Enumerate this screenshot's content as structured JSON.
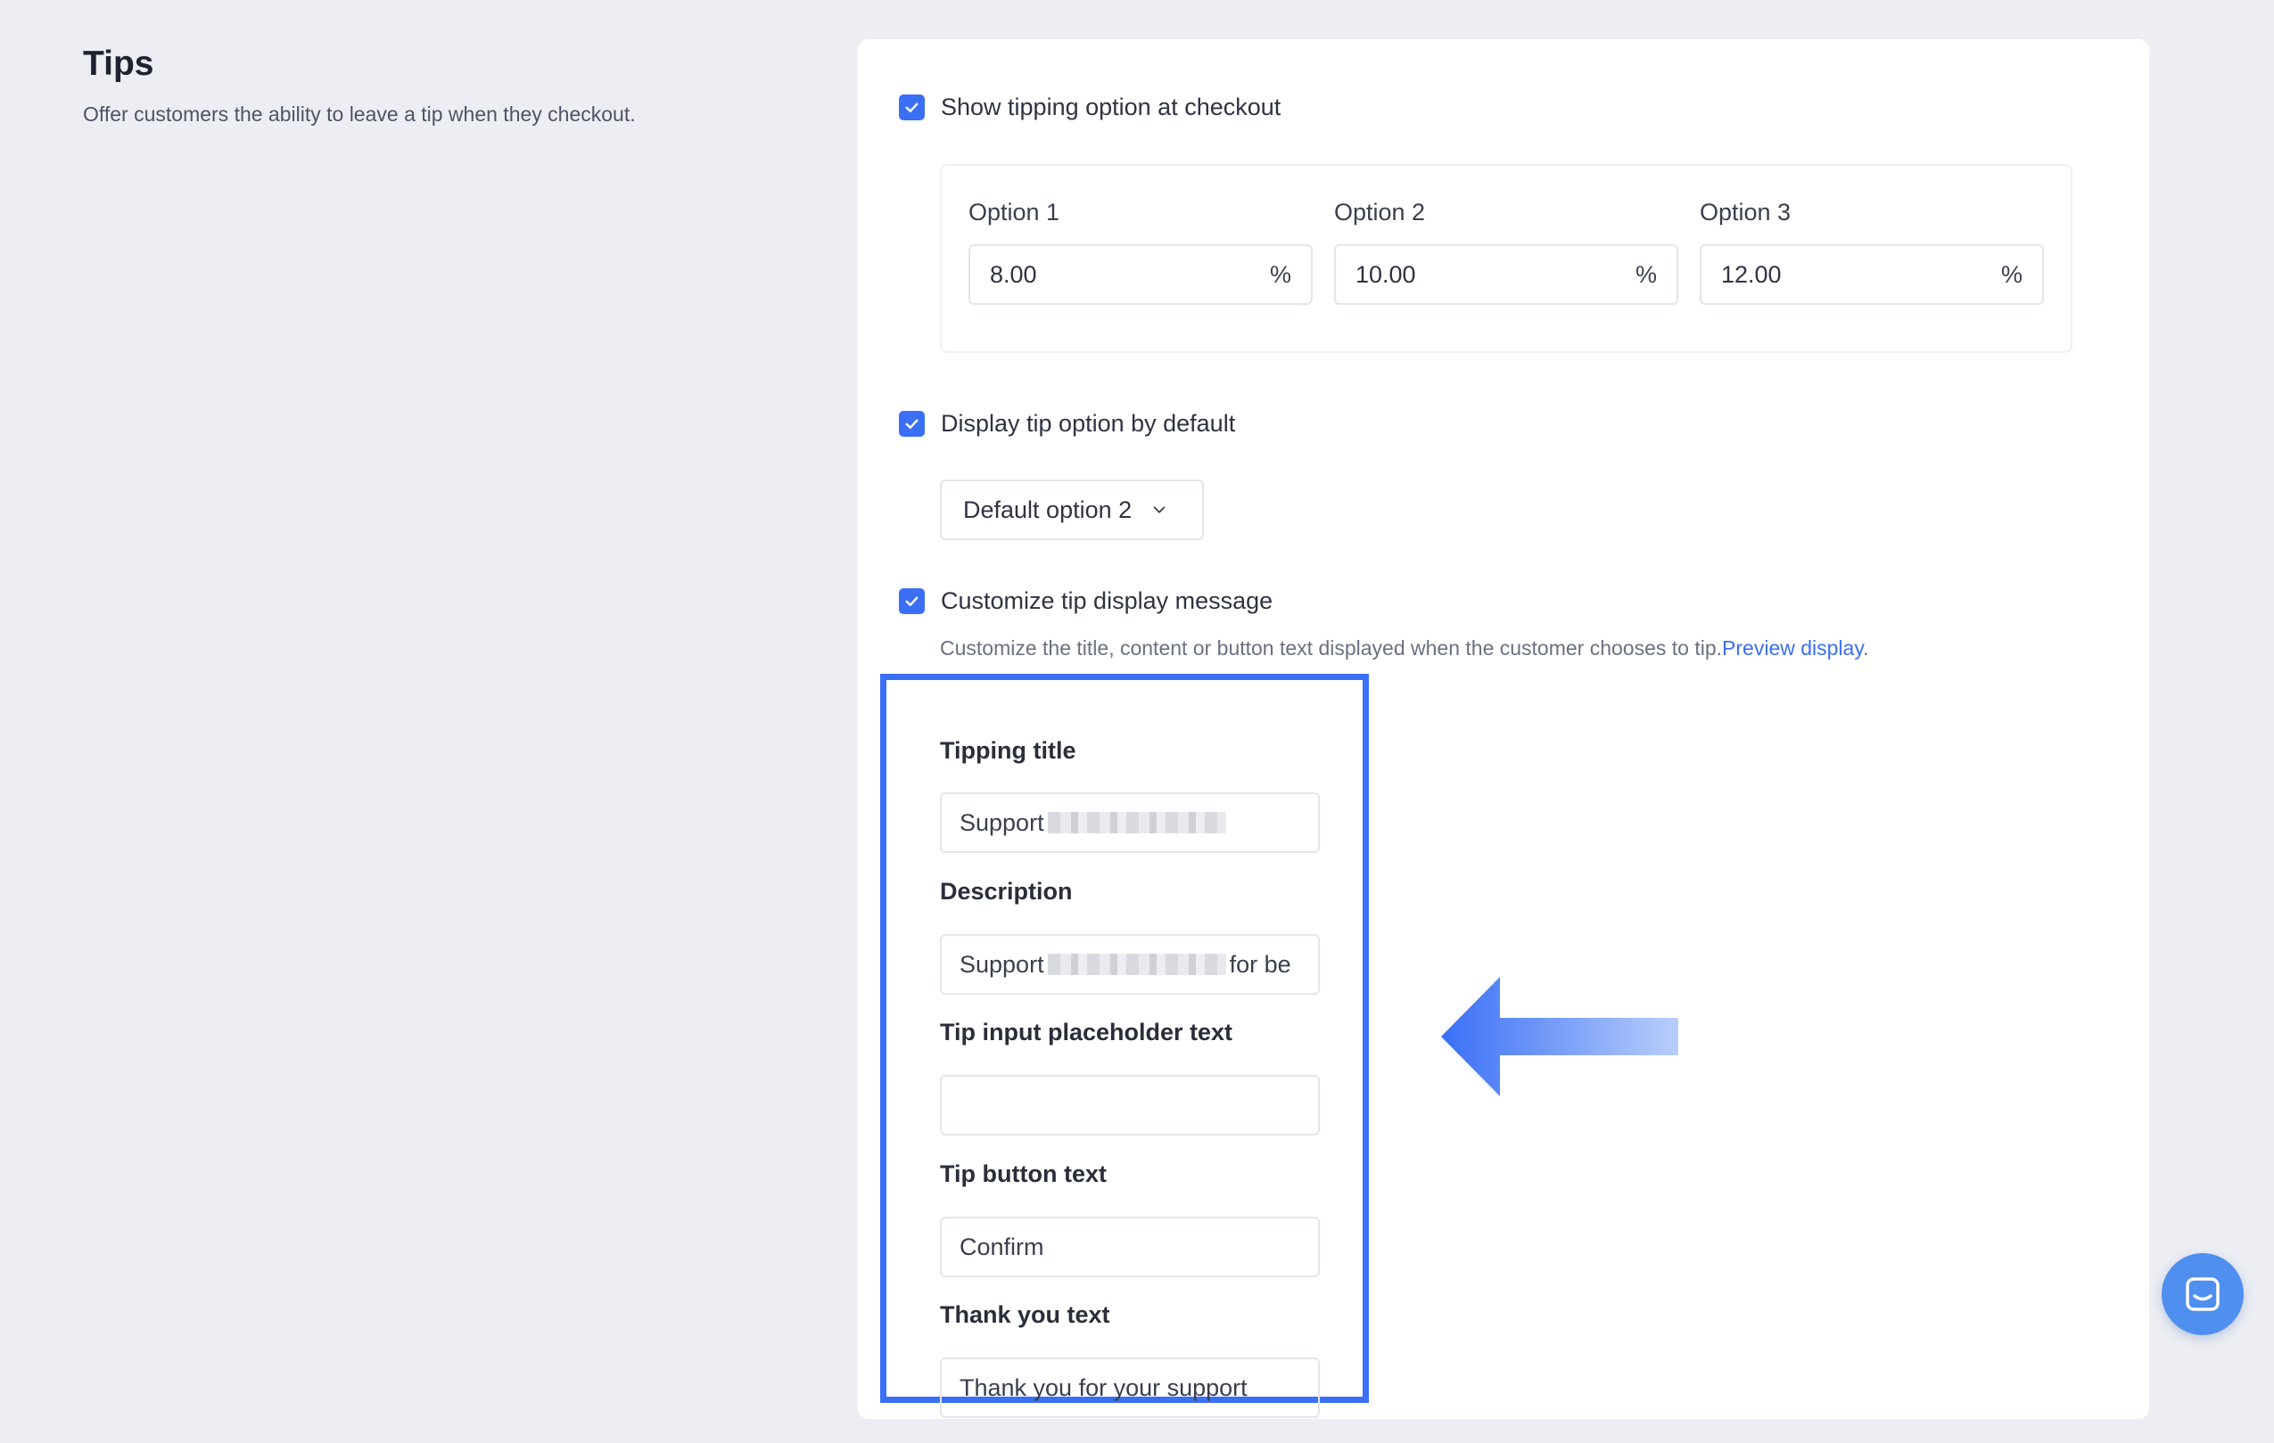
{
  "section": {
    "title": "Tips",
    "description": "Offer customers the ability to leave a tip when they checkout."
  },
  "tipping": {
    "show_label": "Show tipping option at checkout",
    "show_checked": true,
    "options": [
      {
        "label": "Option 1",
        "value": "8.00",
        "suffix": "%"
      },
      {
        "label": "Option 2",
        "value": "10.00",
        "suffix": "%"
      },
      {
        "label": "Option 3",
        "value": "12.00",
        "suffix": "%"
      }
    ]
  },
  "default_tip": {
    "label": "Display tip option by default",
    "checked": true,
    "selected": "Default option 2"
  },
  "customize": {
    "label": "Customize tip display message",
    "checked": true,
    "help": "Customize the title, content or button text displayed when the customer chooses to tip.",
    "link": "Preview display",
    "link_suffix": ".",
    "fields": {
      "title": {
        "label": "Tipping title",
        "value_prefix": "Support"
      },
      "description": {
        "label": "Description",
        "value_prefix": "Support",
        "value_suffix": "for be"
      },
      "placeholder": {
        "label": "Tip input placeholder text",
        "value": ""
      },
      "button": {
        "label": "Tip button text",
        "value": "Confirm"
      },
      "thanks": {
        "label": "Thank you text",
        "value": "Thank you for your support"
      }
    }
  },
  "colors": {
    "accent": "#3b6ff5",
    "highlight": "#3a6ff6",
    "background": "#eceef3",
    "chat": "#4f8ff0"
  },
  "icons": {
    "checkbox": "check-icon",
    "select": "chevron-down-icon",
    "chat": "chat-icon",
    "annotation": "arrow-left-icon"
  }
}
